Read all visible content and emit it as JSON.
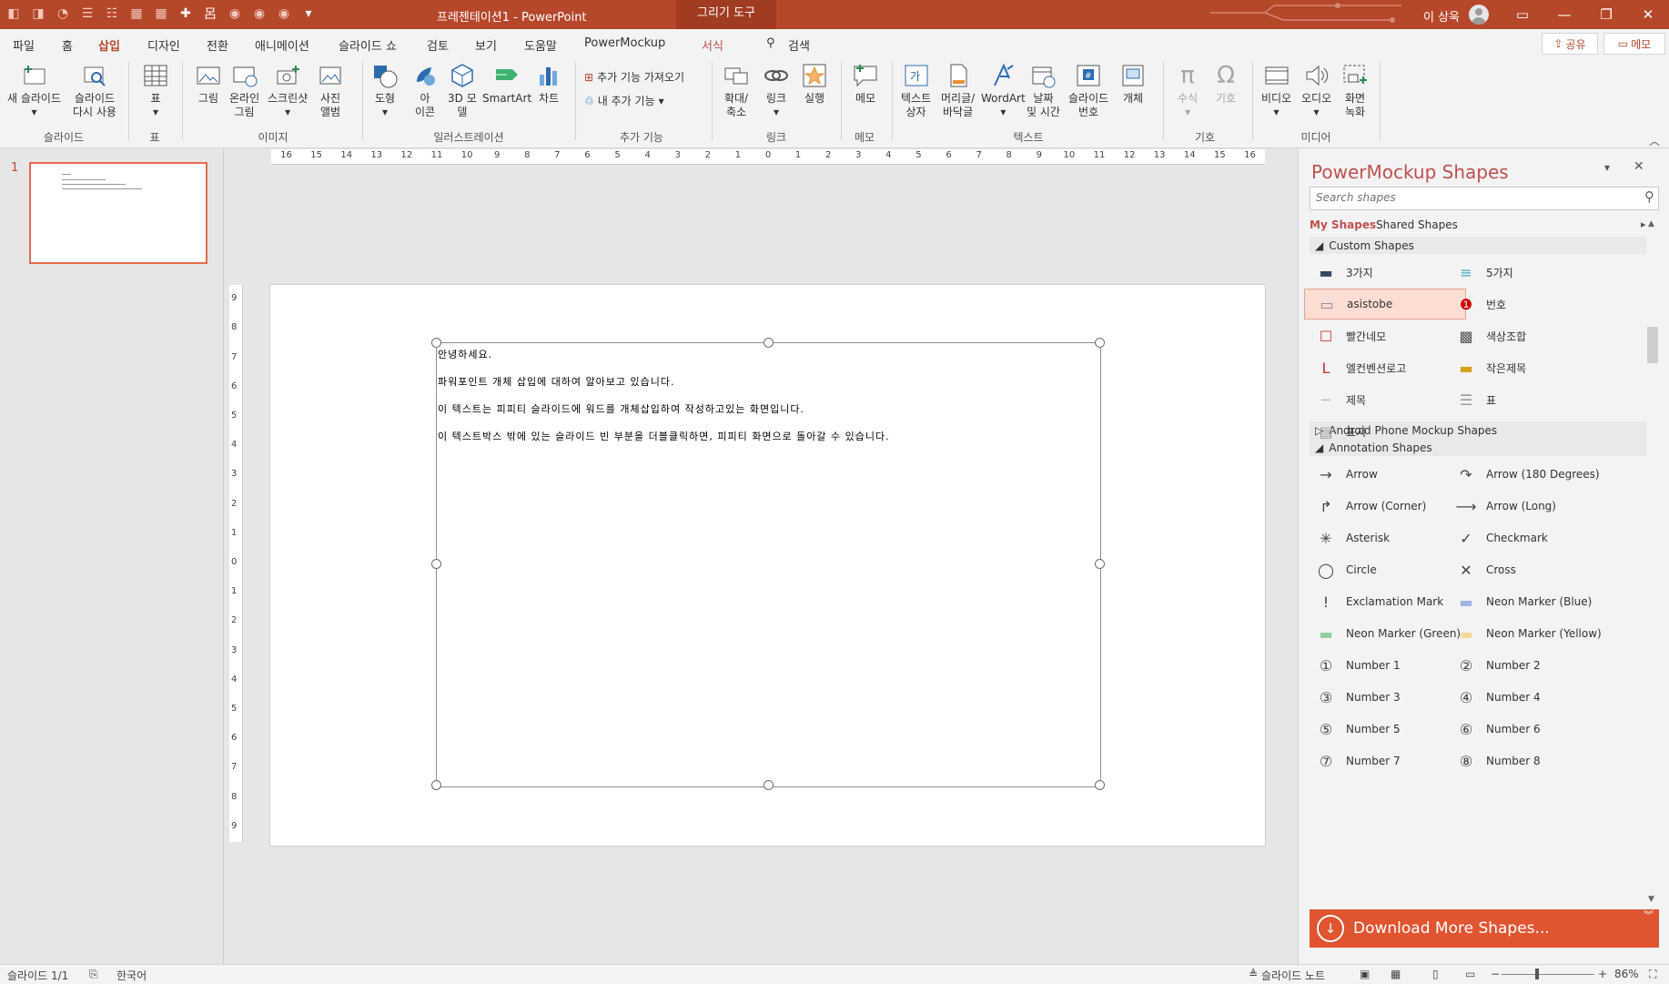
{
  "titlebar": {
    "doc_title": "프레젠테이션1  -  PowerPoint",
    "context_tab": "그리기 도구",
    "user_name": "이 상욱"
  },
  "tabs": {
    "file": "파일",
    "home": "홈",
    "insert": "삽입",
    "design": "디자인",
    "transitions": "전환",
    "animations": "애니메이션",
    "slideshow": "슬라이드 쇼",
    "review": "검토",
    "view": "보기",
    "help": "도움말",
    "powermockup": "PowerMockup",
    "format": "서식",
    "search": "검색",
    "share": "공유",
    "memo": "메모"
  },
  "ribbon": {
    "new_slide": [
      "새 슬라이드",
      ""
    ],
    "reuse_slide": [
      "슬라이드",
      "다시 사용"
    ],
    "table": "표",
    "picture": "그림",
    "online_picture": [
      "온라인",
      "그림"
    ],
    "screenshot": "스크린샷",
    "photo_album": [
      "사진",
      "앨범"
    ],
    "shapes": "도형",
    "icons": [
      "아",
      "이콘"
    ],
    "model3d": [
      "3D 모",
      "델"
    ],
    "smartart": "SmartArt",
    "chart": "차트",
    "get_addins": "추가 기능 가져오기",
    "my_addins": "내 추가 기능",
    "zoom": [
      "확대/",
      "축소"
    ],
    "link": "링크",
    "action": "실행",
    "comment": "메모",
    "textbox": [
      "텍스트",
      "상자"
    ],
    "header_footer": [
      "머리글/",
      "바닥글"
    ],
    "wordart": "WordArt",
    "datetime": [
      "날짜",
      "및 시간"
    ],
    "slide_number": [
      "슬라이드",
      "번호"
    ],
    "object": "개체",
    "equation": "수식",
    "symbol": "기호",
    "video": "비디오",
    "audio": "오디오",
    "screen_recording": [
      "화면",
      "녹화"
    ],
    "groups": {
      "slides": "슬라이드",
      "tables": "표",
      "images": "이미지",
      "illustrations": "일러스트레이션",
      "addins": "추가 기능",
      "links": "링크",
      "comments": "메모",
      "text": "텍스트",
      "symbols": "기호",
      "media": "미디어"
    }
  },
  "thumbnail": {
    "number": "1"
  },
  "ruler": {
    "h_labels": [
      "16",
      "15",
      "14",
      "13",
      "12",
      "11",
      "10",
      "9",
      "8",
      "7",
      "6",
      "5",
      "4",
      "3",
      "2",
      "1",
      "0",
      "1",
      "2",
      "3",
      "4",
      "5",
      "6",
      "7",
      "8",
      "9",
      "10",
      "11",
      "12",
      "13",
      "14",
      "15",
      "16"
    ],
    "v_labels": [
      "9",
      "8",
      "7",
      "6",
      "5",
      "4",
      "3",
      "2",
      "1",
      "0",
      "1",
      "2",
      "3",
      "4",
      "5",
      "6",
      "7",
      "8",
      "9"
    ]
  },
  "slide": {
    "lines": [
      "안녕하세요.",
      "파워포인트 개체 삽입에 대하여 알아보고 있습니다.",
      "이 텍스트는 피피티 슬라이드에 워드를 개체삽입하여 작성하고있는 화면입니다.",
      "이 텍스트박스 밖에 있는 슬라이드 빈 부분을 더블클릭하면, 피피티 화면으로 돌아갈 수 있습니다."
    ]
  },
  "pm": {
    "title": "PowerMockup Shapes",
    "search_placeholder": "Search shapes",
    "tab_my": "My Shapes",
    "tab_shared": "Shared Shapes",
    "sec_custom": "Custom Shapes",
    "sec_android": "Android Phone Mockup Shapes",
    "sec_annotation": "Annotation Shapes",
    "custom": [
      "3가지",
      "5가지",
      "asistobe",
      "번호",
      "빨간네모",
      "색상조합",
      "엘컨벤션로고",
      "작은제목",
      "제목",
      "표",
      "표지"
    ],
    "annotation": [
      "Arrow",
      "Arrow (180 Degrees)",
      "Arrow (Corner)",
      "Arrow (Long)",
      "Asterisk",
      "Checkmark",
      "Circle",
      "Cross",
      "Exclamation Mark",
      "Neon Marker (Blue)",
      "Neon Marker (Green)",
      "Neon Marker (Yellow)",
      "Number 1",
      "Number 2",
      "Number 3",
      "Number 4",
      "Number 5",
      "Number 6",
      "Number 7",
      "Number 8"
    ],
    "download": "Download More Shapes..."
  },
  "status": {
    "slide_count": "슬라이드 1/1",
    "language": "한국어",
    "notes": "슬라이드 노트",
    "zoom": "86%"
  },
  "colors": {
    "accent": "#b7472a",
    "download_bar": "#e0542f"
  }
}
